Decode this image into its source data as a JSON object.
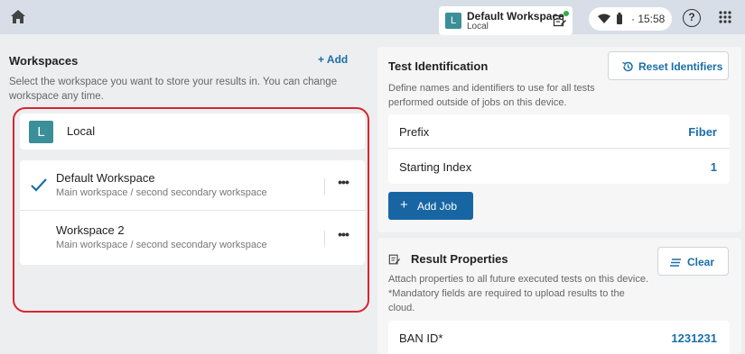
{
  "topbar": {
    "workspace_badge": "L",
    "workspace_name": "Default Workspace",
    "workspace_location": "Local",
    "time": "· 15:58",
    "help": "?",
    "accent": "#3a8f98",
    "notify_color": "#2fae45"
  },
  "workspaces": {
    "title": "Workspaces",
    "add_label": "+ Add",
    "description": "Select the workspace you want to store your results in. You can change workspace any time.",
    "local": {
      "badge": "L",
      "name": "Local"
    },
    "items": [
      {
        "name": "Default Workspace",
        "path": "Main workspace / second secondary workspace",
        "selected": true,
        "more": "•••"
      },
      {
        "name": "Workspace 2",
        "path": "Main workspace / second secondary workspace",
        "selected": false,
        "more": "•••"
      }
    ]
  },
  "test_identification": {
    "title": "Test Identification",
    "reset_label": "Reset Identifiers",
    "description": "Define names and identifiers to use for all tests performed outside of jobs on this device.",
    "fields": [
      {
        "label": "Prefix",
        "value": "Fiber"
      },
      {
        "label": "Starting Index",
        "value": "1"
      }
    ],
    "add_job_plus": "+",
    "add_job_label": "Add Job"
  },
  "result_properties": {
    "title": "Result Properties",
    "clear_label": "Clear",
    "description": "Attach properties to all future executed tests on this device. *Mandatory fields are required to upload results to the cloud.",
    "fields": [
      {
        "label": "BAN ID*",
        "value": "1231231"
      }
    ]
  },
  "colors": {
    "link": "#1a6fa8",
    "primary": "#1766a3",
    "highlight": "#d8262f"
  }
}
